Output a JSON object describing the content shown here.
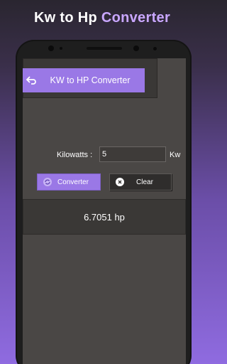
{
  "promo": {
    "title_part1": "Kw to Hp",
    "title_part2": "Converter"
  },
  "appbar": {
    "title": "KW to HP Converter",
    "back_icon": "back-arrow-icon"
  },
  "form": {
    "label": "Kilowatts :",
    "value": "5",
    "unit": "Kw"
  },
  "buttons": {
    "convert_label": "Converter",
    "clear_label": "Clear"
  },
  "result": {
    "text": "6.7051 hp"
  },
  "colors": {
    "accent": "#9a78e6",
    "screen_bg": "#4a4745",
    "panel_bg": "#3a3836"
  }
}
